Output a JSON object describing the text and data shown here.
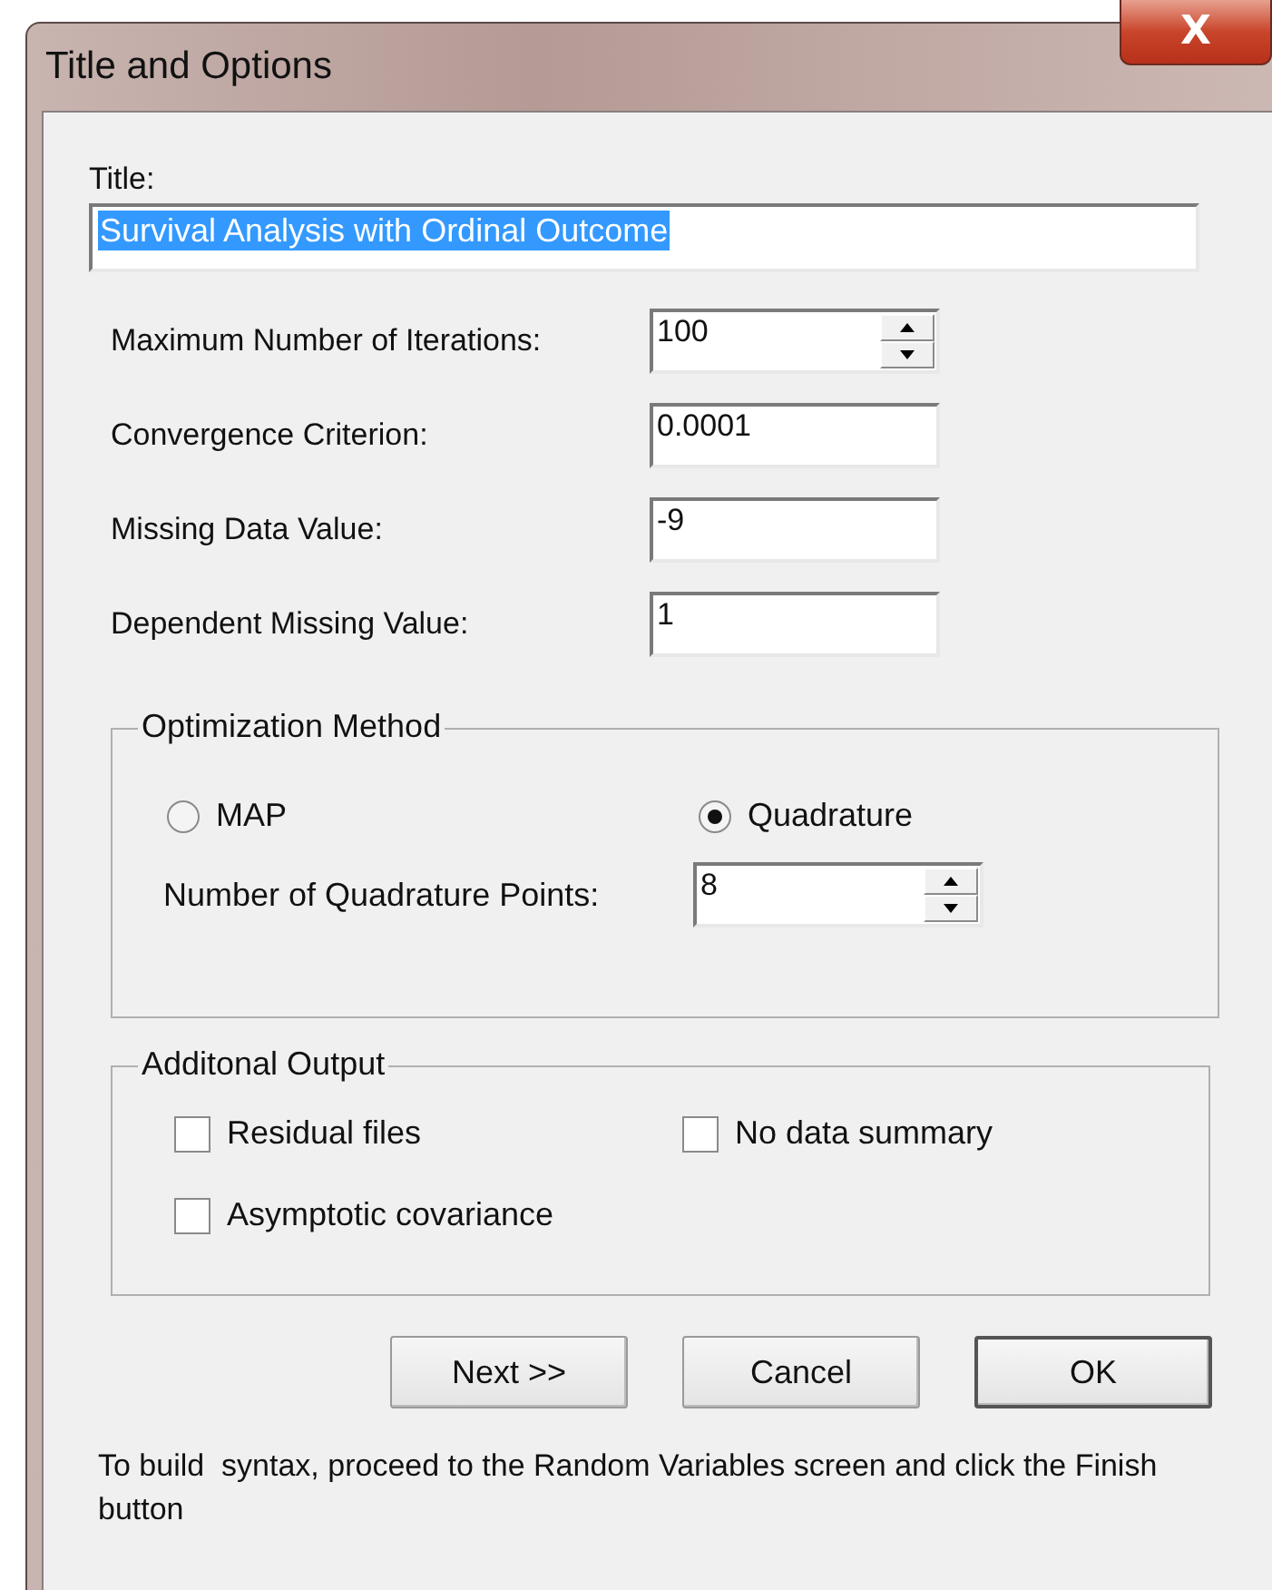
{
  "window": {
    "title": "Title and Options",
    "close_icon": "X"
  },
  "title_field": {
    "label": "Title:",
    "value": "Survival Analysis with Ordinal Outcome",
    "selected": true
  },
  "fields": [
    {
      "kind": "spin",
      "label": "Maximum Number of Iterations:",
      "value": "100"
    },
    {
      "kind": "text",
      "label": "Convergence Criterion:",
      "value": "0.0001"
    },
    {
      "kind": "text",
      "label": "Missing Data Value:",
      "value": "-9"
    },
    {
      "kind": "text",
      "label": "Dependent Missing Value:",
      "value": "1"
    }
  ],
  "optimization": {
    "legend": "Optimization Method",
    "options": [
      {
        "label": "MAP",
        "selected": false
      },
      {
        "label": "Quadrature",
        "selected": true
      }
    ],
    "points": {
      "label": "Number of Quadrature Points:",
      "value": "8"
    }
  },
  "output": {
    "legend": "Additonal Output",
    "options": [
      {
        "label": "Residual files",
        "checked": false
      },
      {
        "label": "No data summary",
        "checked": false
      },
      {
        "label": "Asymptotic covariance",
        "checked": false
      }
    ]
  },
  "buttons": [
    {
      "label": "Next >>",
      "default": false
    },
    {
      "label": "Cancel",
      "default": false
    },
    {
      "label": "OK",
      "default": true
    }
  ],
  "note": "To build  syntax, proceed to the Random Variables screen and click the Finish button"
}
